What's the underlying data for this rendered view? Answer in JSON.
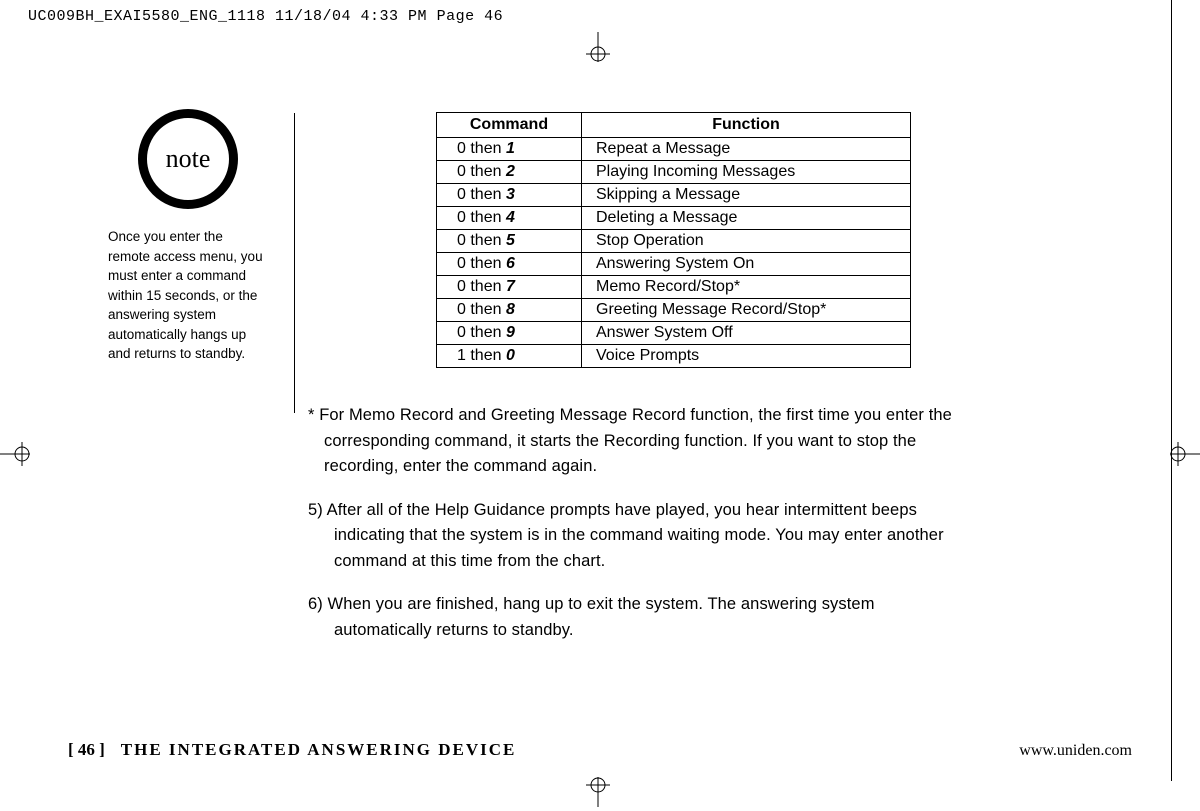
{
  "header": {
    "jobline": "UC009BH_EXAI5580_ENG_1118  11/18/04  4:33 PM  Page 46"
  },
  "note": {
    "label": "note",
    "text": "Once you enter the remote access menu, you must enter a command within 15 seconds, or the answering system automatically hangs up and returns to standby."
  },
  "table": {
    "head_command": "Command",
    "head_function": "Function",
    "rows": [
      {
        "prefix": "0 then ",
        "num": "1",
        "fn": "Repeat a Message"
      },
      {
        "prefix": "0 then ",
        "num": "2",
        "fn": "Playing Incoming Messages"
      },
      {
        "prefix": "0 then ",
        "num": "3",
        "fn": "Skipping a Message"
      },
      {
        "prefix": "0 then ",
        "num": "4",
        "fn": "Deleting a Message"
      },
      {
        "prefix": "0 then ",
        "num": "5",
        "fn": "Stop Operation"
      },
      {
        "prefix": "0 then ",
        "num": "6",
        "fn": "Answering System On"
      },
      {
        "prefix": "0 then ",
        "num": "7",
        "fn": "Memo Record/Stop*"
      },
      {
        "prefix": "0 then ",
        "num": "8",
        "fn": "Greeting Message Record/Stop*"
      },
      {
        "prefix": "0 then ",
        "num": "9",
        "fn": "Answer System Off"
      },
      {
        "prefix": "1 then ",
        "num": "0",
        "fn": "Voice Prompts"
      }
    ]
  },
  "paragraphs": {
    "star_note": "* For Memo Record and Greeting Message Record function, the first time you enter the corresponding command, it starts the Recording function. If you want to stop the recording, enter the command again.",
    "step5": "5) After all of the Help Guidance prompts have played, you hear intermittent beeps indicating that the system is in the command waiting mode. You may enter another command at this time from the chart.",
    "step6": "6) When you are finished, hang up to exit the system. The answering system automatically returns to standby."
  },
  "footer": {
    "page": "[ 46 ]",
    "section": "THE INTEGRATED ANSWERING DEVICE",
    "url": "www.uniden.com"
  }
}
